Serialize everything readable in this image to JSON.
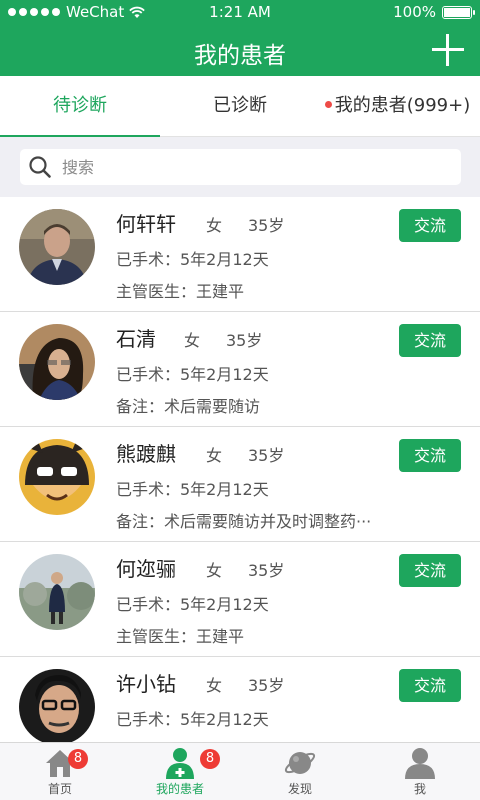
{
  "status_bar": {
    "carrier": "WeChat",
    "time": "1:21 AM",
    "battery": "100%",
    "battery_level": 1.0
  },
  "nav": {
    "title": "我的患者",
    "add_icon": "plus-icon"
  },
  "tabs": [
    {
      "label": "待诊断",
      "active": true
    },
    {
      "label": "已诊断",
      "active": false
    },
    {
      "label": "我的患者(999+)",
      "active": false,
      "dot": true
    }
  ],
  "search": {
    "placeholder": "搜索",
    "icon": "search-icon"
  },
  "patients": [
    {
      "name": "何轩轩",
      "gender": "女",
      "age": "35岁",
      "surgery": "已手术：5年2月12天",
      "extra": "主管医生：王建平",
      "button": "交流"
    },
    {
      "name": "石清",
      "gender": "女",
      "age": "35岁",
      "surgery": "已手术：5年2月12天",
      "extra": "备注：术后需要随访",
      "button": "交流"
    },
    {
      "name": "熊踱麒",
      "gender": "女",
      "age": "35岁",
      "surgery": "已手术：5年2月12天",
      "extra": "备注：术后需要随访并及时调整药···",
      "button": "交流"
    },
    {
      "name": "何迩骊",
      "gender": "女",
      "age": "35岁",
      "surgery": "已手术：5年2月12天",
      "extra": "主管医生：王建平",
      "button": "交流"
    },
    {
      "name": "许小钻",
      "gender": "女",
      "age": "35岁",
      "surgery": "已手术：5年2月12天",
      "extra": "",
      "button": "交流"
    }
  ],
  "tabbar": [
    {
      "label": "首页",
      "icon": "home-icon",
      "badge": "8",
      "active": false
    },
    {
      "label": "我的患者",
      "icon": "patients-icon",
      "badge": "8",
      "active": true
    },
    {
      "label": "发现",
      "icon": "discover-icon",
      "badge": "",
      "active": false
    },
    {
      "label": "我",
      "icon": "profile-icon",
      "badge": "",
      "active": false
    }
  ],
  "colors": {
    "brand": "#1ea65d",
    "badge": "#ee3b35",
    "background": "#efeff4"
  }
}
